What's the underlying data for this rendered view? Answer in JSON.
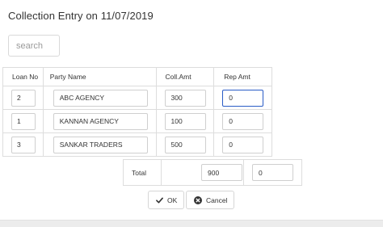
{
  "page": {
    "title": "Collection Entry on 11/07/2019"
  },
  "search": {
    "placeholder": "search",
    "value": ""
  },
  "grid": {
    "headers": {
      "loan_no": "Loan No",
      "party_name": "Party Name",
      "coll_amt": "Coll.Amt",
      "rep_amt": "Rep Amt"
    },
    "rows": [
      {
        "loan_no": "2",
        "party_name": "ABC AGENCY",
        "coll_amt": "300",
        "rep_amt": "0"
      },
      {
        "loan_no": "1",
        "party_name": "KANNAN AGENCY",
        "coll_amt": "100",
        "rep_amt": "0"
      },
      {
        "loan_no": "3",
        "party_name": "SANKAR TRADERS",
        "coll_amt": "500",
        "rep_amt": "0"
      }
    ]
  },
  "totals": {
    "label": "Total",
    "coll_amt": "900",
    "rep_amt": "0"
  },
  "actions": {
    "ok_label": "OK",
    "cancel_label": "Cancel"
  },
  "icons": {
    "ok": "checkmark-icon",
    "cancel": "close-circle-icon"
  },
  "colors": {
    "active_border": "#2a5cc6",
    "border": "#dddddd",
    "text": "#333333"
  }
}
